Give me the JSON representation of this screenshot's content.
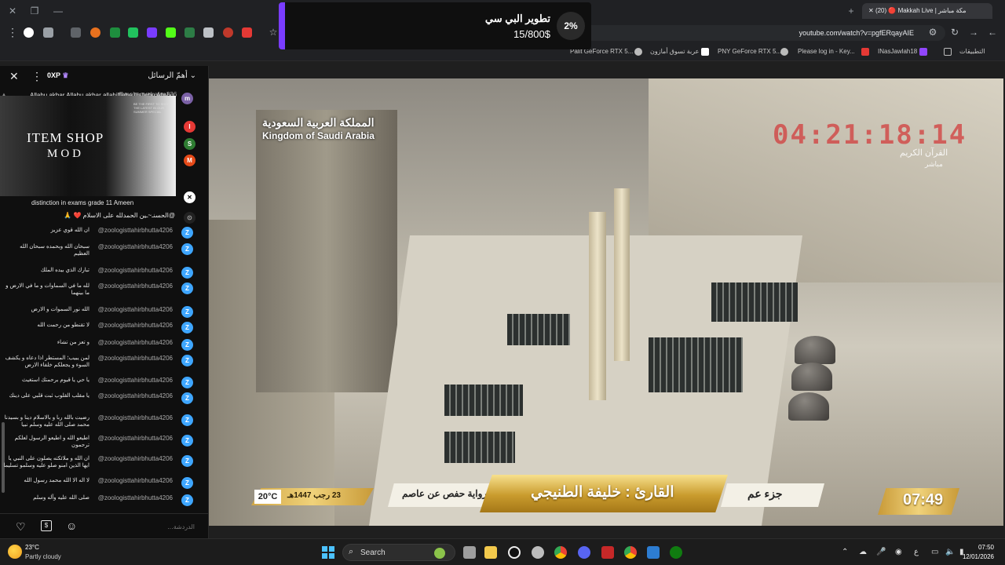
{
  "browser": {
    "tab_title": "(20) 🔴 Makkah Live | مكة مباشر",
    "url": "youtube.com/watch?v=pgfERqayAIE",
    "bookmarks": [
      "Palit GeForce RTX 5...",
      "عربة تسوق أمازون",
      "PNY GeForce RTX 5...",
      "Please log in - Key...",
      "INasJawlah18",
      "التطبيقات"
    ]
  },
  "notification": {
    "title": "تطوير البي سي",
    "amount": "15/800$",
    "percent": "2%"
  },
  "chat": {
    "xp": "0XP",
    "mode_label": "أهمّ الرسائل",
    "input_placeholder": "الدردشة...",
    "item_shop_line1": "ITEM SHOP",
    "item_shop_line2": "MOD",
    "item_shop_small": "BE THE FIRST TO SHOP THE LATEST IN OUR SUMMER SPECIAL",
    "top_message": {
      "user": "@mohemedrafee336",
      "text": "Allahu akbar Allahu akbar allahilllaha illallahu Allahu akbar Allahu akbar",
      "avatar": "m"
    },
    "side_avatars": [
      "I",
      "S",
      "M"
    ],
    "partial_message": "distinction in exams grade 11 Ameen",
    "sticker_message": "@الحسنـ~ـين الحمدلله على الاسلام ❤️ 🙏",
    "messages": [
      {
        "user": "@zoologisttahirbhutta4206",
        "text": "ان الله قوي عزيز"
      },
      {
        "user": "@zoologisttahirbhutta4206",
        "text": "سبحان الله وبحمده سبحان الله العظيم"
      },
      {
        "user": "@zoologisttahirbhutta4206",
        "text": "تبارك الذي بيده الملك"
      },
      {
        "user": "@zoologisttahirbhutta4206",
        "text": "لله ما في السماوات و ما في الارض و ما بينهما"
      },
      {
        "user": "@zoologisttahirbhutta4206",
        "text": "الله نور السموات و الارض"
      },
      {
        "user": "@zoologisttahirbhutta4206",
        "text": "لا تقنطو من رحمت الله"
      },
      {
        "user": "@zoologisttahirbhutta4206",
        "text": "و تعز من تشاء"
      },
      {
        "user": "@zoologisttahirbhutta4206",
        "text": "لمن يبيب؛ المستطر اذا دعاه و يكشف السوء و يجعلكم خلفاء الارض"
      },
      {
        "user": "@zoologisttahirbhutta4206",
        "text": "يا حي يا قيوم برحمتك استغيث"
      },
      {
        "user": "@zoologisttahirbhutta4206",
        "text": "يا مقلب القلوب ثبت قلبي على دينك"
      },
      {
        "user": "@zoologisttahirbhutta4206",
        "text": "رضيت بالله ربا و بالاسلام دينا و بسيدنا محمد صلى الله عليه وسلم نبيا"
      },
      {
        "user": "@zoologisttahirbhutta4206",
        "text": "اطيعو الله و اطيعو الرسول لعلكم ترحمون"
      },
      {
        "user": "@zoologisttahirbhutta4206",
        "text": "ان الله و ملائكته يصلون على النبي يا ايها الذين امنو صلو عليه وسلمو تسليما"
      },
      {
        "user": "@zoologisttahirbhutta4206",
        "text": "لا اله الا الله محمد رسول الله"
      },
      {
        "user": "@zoologisttahirbhutta4206",
        "text": "صلى الله عليه وآله وسلم"
      }
    ]
  },
  "video": {
    "country_ar": "المملكة العربية السعودية",
    "country_en": "Kingdom of Saudi Arabia",
    "clock": "04:21:18:14",
    "channel_ar": "القرآن الكريم",
    "channel_live": "مباشر",
    "temperature": "20°C",
    "hijri_date": "23 رجب 1447هـ",
    "riwaya": "رواية حفص عن عاصم",
    "qari": "القارئ : خليفة الطنيجي",
    "juz": "جزء عم",
    "time": "07:49"
  },
  "taskbar": {
    "weather_temp": "23°C",
    "weather_desc": "Partly cloudy",
    "search_label": "Search",
    "lang": "ع",
    "time": "07:50",
    "date": "12/01/2026"
  },
  "colors": {
    "youtube_bg": "#0f0f0f",
    "gold": "#d1a746",
    "accent_purple": "#7a3cff",
    "avatar_blue": "#3ea6ff"
  }
}
